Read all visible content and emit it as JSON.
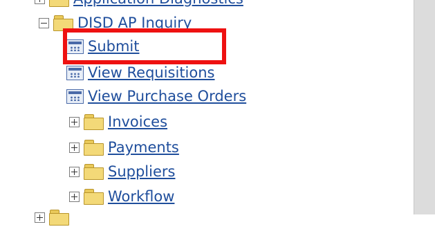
{
  "tree": {
    "parent_partial": "Application Diagnostics",
    "group": {
      "label": "DISD AP Inquiry",
      "functions": [
        "Submit",
        "View Requisitions",
        "View Purchase Orders"
      ],
      "subfolders": [
        "Invoices",
        "Payments",
        "Suppliers",
        "Workflow"
      ]
    }
  },
  "colors": {
    "link": "#1f4e9c",
    "highlight": "#ee1111",
    "folder": "#f3d978",
    "scrollbar": "#dcdcdc"
  }
}
